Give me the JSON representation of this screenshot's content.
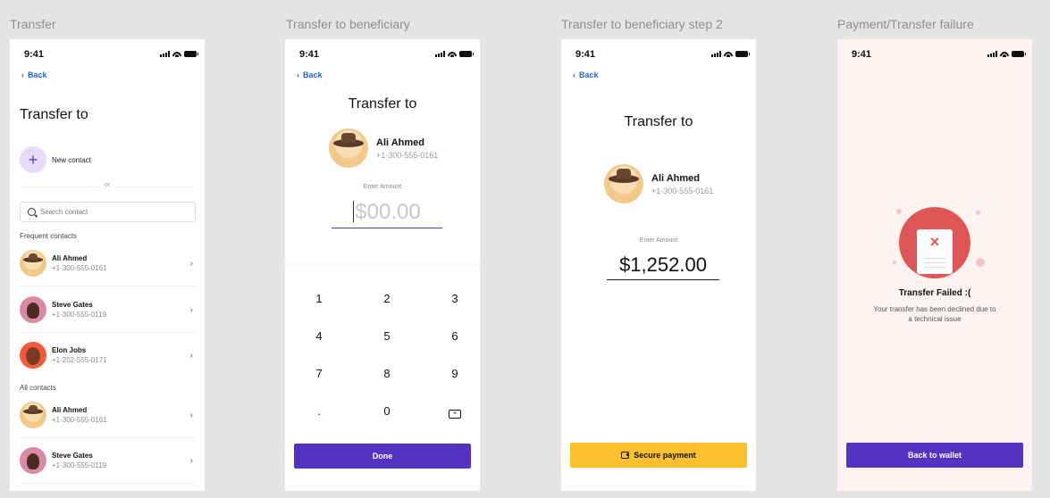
{
  "frames": [
    {
      "label": "Transfer"
    },
    {
      "label": "Transfer to beneficiary"
    },
    {
      "label": "Transfer to beneficiary step 2"
    },
    {
      "label": "Payment/Transfer failure"
    }
  ],
  "status_time": "9:41",
  "back_label": "Back",
  "screen1": {
    "title": "Transfer to",
    "new_contact": "New contact",
    "or": "or",
    "search_placeholder": "Search contact",
    "frequent_label": "Frequent contacts",
    "all_label": "All contacts",
    "frequent": [
      {
        "name": "Ali Ahmed",
        "phone": "+1-300-555-0161"
      },
      {
        "name": "Steve Gates",
        "phone": "+1-300-555-0119"
      },
      {
        "name": "Elon Jobs",
        "phone": "+1-202-555-0171"
      }
    ],
    "all": [
      {
        "name": "Ali Ahmed",
        "phone": "+1-300-555-0161"
      },
      {
        "name": "Steve Gates",
        "phone": "+1-300-555-0119"
      }
    ]
  },
  "screen2": {
    "title": "Transfer to",
    "beneficiary": {
      "name": "Ali Ahmed",
      "phone": "+1-300-555-0161"
    },
    "enter_amount": "Enter Amount",
    "amount_placeholder": "$00.00",
    "keys": [
      "1",
      "2",
      "3",
      "4",
      "5",
      "6",
      "7",
      "8",
      "9",
      ".",
      "0"
    ],
    "done": "Done"
  },
  "screen3": {
    "title": "Transfer to",
    "beneficiary": {
      "name": "Ali Ahmed",
      "phone": "+1-300-555-0161"
    },
    "enter_amount": "Enter Amount",
    "amount": "$1,252.00",
    "secure_payment": "Secure payment"
  },
  "screen4": {
    "title": "Transfer Failed :(",
    "message": "Your transfer has been declined due to a technical issue",
    "back_to_wallet": "Back to wallet"
  },
  "colors": {
    "primary": "#5433c0",
    "secondary": "#fbc02d",
    "link": "#1f67d8",
    "error": "#e05656"
  }
}
